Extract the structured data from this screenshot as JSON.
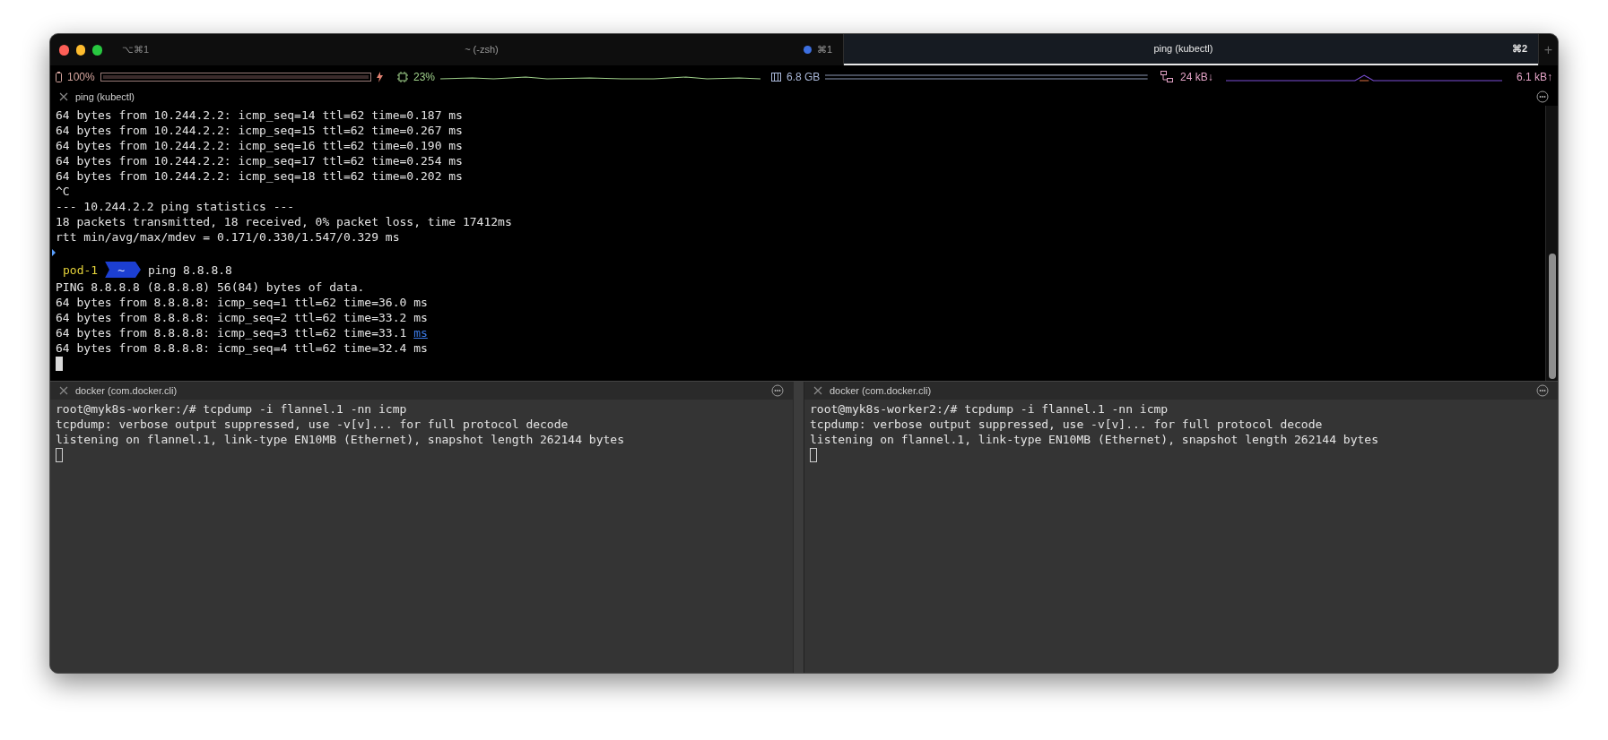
{
  "window": {
    "shortcut": "⌥⌘1"
  },
  "tabs": [
    {
      "title": "~ (-zsh)",
      "shortcut": "⌘1",
      "activity": true,
      "selected": false
    },
    {
      "title": "ping (kubectl)",
      "shortcut": "⌘2",
      "activity": false,
      "selected": true
    }
  ],
  "new_tab": "+",
  "status_bar": [
    {
      "kind": "battery",
      "text": "100%",
      "level": 1,
      "charging": true
    },
    {
      "kind": "cpu",
      "text": "23%"
    },
    {
      "kind": "memory",
      "text": "6.8 GB"
    },
    {
      "kind": "network",
      "text": "24 kB↓",
      "text_2": "6.1 kB↑"
    }
  ],
  "top_pane": {
    "title": "ping (kubectl)",
    "lines": [
      {
        "kind": "out",
        "text": "64 bytes from 10.244.2.2: icmp_seq=14 ttl=62 time=0.187 ms"
      },
      {
        "kind": "out",
        "text": "64 bytes from 10.244.2.2: icmp_seq=15 ttl=62 time=0.267 ms"
      },
      {
        "kind": "out",
        "text": "64 bytes from 10.244.2.2: icmp_seq=16 ttl=62 time=0.190 ms"
      },
      {
        "kind": "out",
        "text": "64 bytes from 10.244.2.2: icmp_seq=17 ttl=62 time=0.254 ms"
      },
      {
        "kind": "out",
        "text": "64 bytes from 10.244.2.2: icmp_seq=18 ttl=62 time=0.202 ms"
      },
      {
        "kind": "out",
        "text": "^C"
      },
      {
        "kind": "out",
        "text": "--- 10.244.2.2 ping statistics ---"
      },
      {
        "kind": "out",
        "text": "18 packets transmitted, 18 received, 0% packet loss, time 17412ms"
      },
      {
        "kind": "out",
        "text": "rtt min/avg/max/mdev = 0.171/0.330/1.547/0.329 ms"
      },
      {
        "kind": "mark"
      },
      {
        "kind": "prompt",
        "host": "pod-1",
        "dir": "~",
        "command": "ping 8.8.8.8"
      },
      {
        "kind": "out",
        "text": "PING 8.8.8.8 (8.8.8.8) 56(84) bytes of data."
      },
      {
        "kind": "out",
        "text": "64 bytes from 8.8.8.8: icmp_seq=1 ttl=62 time=36.0 ms"
      },
      {
        "kind": "out",
        "text": "64 bytes from 8.8.8.8: icmp_seq=2 ttl=62 time=33.2 ms"
      },
      {
        "kind": "out",
        "text": "64 bytes from 8.8.8.8: icmp_seq=3 ttl=62 time=33.1 ",
        "link": "ms"
      },
      {
        "kind": "out",
        "text": "64 bytes from 8.8.8.8: icmp_seq=4 ttl=62 time=32.4 ms"
      },
      {
        "kind": "cursor",
        "focused": true
      }
    ]
  },
  "bottom_panes": [
    {
      "title": "docker (com.docker.cli)",
      "lines": [
        {
          "kind": "out",
          "text": "root@myk8s-worker:/# tcpdump -i flannel.1 -nn icmp"
        },
        {
          "kind": "out",
          "text": "tcpdump: verbose output suppressed, use -v[v]... for full protocol decode"
        },
        {
          "kind": "out",
          "text": "listening on flannel.1, link-type EN10MB (Ethernet), snapshot length 262144 bytes"
        },
        {
          "kind": "cursor",
          "focused": false
        }
      ]
    },
    {
      "title": "docker (com.docker.cli)",
      "lines": [
        {
          "kind": "out",
          "text": "root@myk8s-worker2:/# tcpdump -i flannel.1 -nn icmp"
        },
        {
          "kind": "out",
          "text": "tcpdump: verbose output suppressed, use -v[v]... for full protocol decode"
        },
        {
          "kind": "out",
          "text": "listening on flannel.1, link-type EN10MB (Ethernet), snapshot length 262144 bytes"
        },
        {
          "kind": "cursor",
          "focused": false
        }
      ]
    }
  ]
}
